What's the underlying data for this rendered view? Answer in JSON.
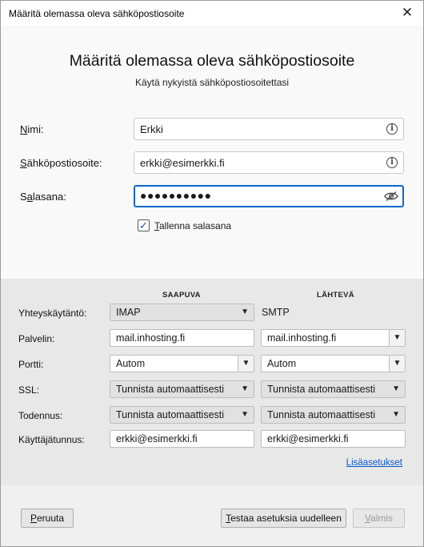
{
  "window": {
    "title": "Määritä olemassa oleva sähköpostiosoite",
    "close_glyph": "✕"
  },
  "header": {
    "heading": "Määritä olemassa oleva sähköpostiosoite",
    "subheading": "Käytä nykyistä sähköpostiosoitettasi"
  },
  "account": {
    "name_label_first": "N",
    "name_label_rest": "imi:",
    "name_value": "Erkki",
    "email_label_first": "S",
    "email_label_rest": "ähköpostiosoite:",
    "email_value": "erkki@esimerkki.fi",
    "password_label_pre": "S",
    "password_label_u": "a",
    "password_label_rest": "lasana:",
    "password_value": "●●●●●●●●●●",
    "remember_checked": true,
    "remember_check_glyph": "✓",
    "remember_label_first": "T",
    "remember_label_rest": "allenna salasana",
    "info_glyph": "i"
  },
  "settings": {
    "incoming_header": "SAAPUVA",
    "outgoing_header": "LÄHTEVÄ",
    "rows": {
      "protocol": {
        "label": "Yhteyskäytäntö:",
        "incoming": "IMAP",
        "outgoing": "SMTP"
      },
      "server": {
        "label": "Palvelin:",
        "incoming": "mail.inhosting.fi",
        "outgoing": "mail.inhosting.fi"
      },
      "port": {
        "label": "Portti:",
        "incoming": "Autom",
        "outgoing": "Autom"
      },
      "ssl": {
        "label": "SSL:",
        "incoming": "Tunnista automaattisesti",
        "outgoing": "Tunnista automaattisesti"
      },
      "auth": {
        "label": "Todennus:",
        "incoming": "Tunnista automaattisesti",
        "outgoing": "Tunnista automaattisesti"
      },
      "username": {
        "label": "Käyttäjätunnus:",
        "incoming": "erkki@esimerkki.fi",
        "outgoing": "erkki@esimerkki.fi"
      }
    },
    "advanced_link": "Lisäasetukset",
    "dropdown_glyph": "▼"
  },
  "buttons": {
    "cancel_first": "P",
    "cancel_rest": "eruuta",
    "retest_first": "T",
    "retest_rest": "estaa asetuksia uudelleen",
    "done_first": "V",
    "done_rest": "almis"
  },
  "colors": {
    "accent": "#0a68c9",
    "link": "#0a58c9"
  }
}
